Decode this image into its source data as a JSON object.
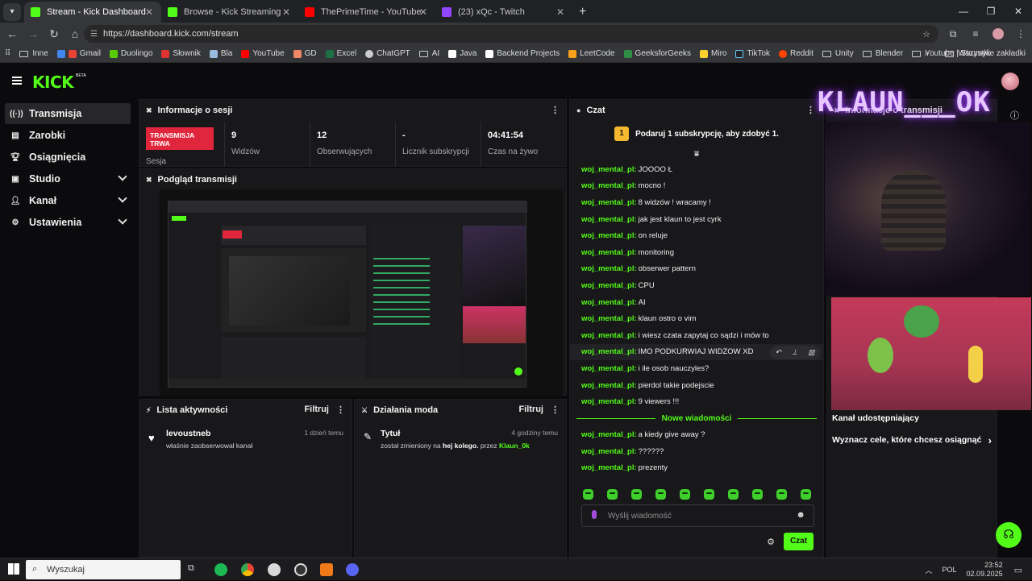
{
  "browser": {
    "tabs": [
      {
        "title": "Stream - Kick Dashboard",
        "active": true,
        "color": "#53fc18"
      },
      {
        "title": "Browse - Kick Streaming",
        "active": false,
        "color": "#53fc18"
      },
      {
        "title": "ThePrimeTime - YouTube",
        "active": false,
        "color": "#ff0000"
      },
      {
        "title": "(23) xQc - Twitch",
        "active": false,
        "color": "#9146ff"
      }
    ],
    "url": "https://dashboard.kick.com/stream",
    "bookmarks": [
      "Inne",
      "Gmail",
      "Duolingo",
      "Słownik",
      "Bla",
      "YouTube",
      "GD",
      "Excel",
      "ChatGPT",
      "AI",
      "Java",
      "Backend Projects",
      "LeetCode",
      "GeeksforGeeks",
      "Miro",
      "TikTok",
      "Reddit",
      "Unity",
      "Blender",
      "Youtube | Strumyk"
    ],
    "bookmarks_all": "Wszystkie zakładki"
  },
  "kick": {
    "logo": "KICK",
    "beta": "BETA",
    "sidebar": [
      {
        "label": "Transmisja",
        "icon": "broadcast-icon",
        "active": true,
        "chevron": false
      },
      {
        "label": "Zarobki",
        "icon": "wallet-icon",
        "active": false,
        "chevron": false
      },
      {
        "label": "Osiągnięcia",
        "icon": "trophy-icon",
        "active": false,
        "chevron": false
      },
      {
        "label": "Studio",
        "icon": "studio-icon",
        "active": false,
        "chevron": true
      },
      {
        "label": "Kanał",
        "icon": "channel-icon",
        "active": false,
        "chevron": true
      },
      {
        "label": "Ustawienia",
        "icon": "gear-icon",
        "active": false,
        "chevron": true
      }
    ],
    "session": {
      "title": "Informacje o sesji",
      "badge": "TRANSMISJA TRWA",
      "sublabel": "Sesja",
      "stats": [
        {
          "value": "9",
          "label": "Widzów"
        },
        {
          "value": "12",
          "label": "Obserwujących"
        },
        {
          "value": "-",
          "label": "Licznik subskrypcji"
        },
        {
          "value": "04:41:54",
          "label": "Czas na żywo"
        }
      ]
    },
    "preview": {
      "title": "Podgląd transmisji"
    },
    "activity": {
      "title": "Lista aktywności",
      "filter": "Filtruj",
      "items": [
        {
          "user": "levoustneb",
          "text": "właśnie zaobserwował kanał",
          "time": "1 dzień temu"
        }
      ]
    },
    "mod": {
      "title": "Działania moda",
      "filter": "Filtruj",
      "items": [
        {
          "heading": "Tytuł",
          "text_pre": "został zmieniony na",
          "bold": "hej kolego.",
          "text_mid": "przez",
          "user": "Klaun_0k",
          "time": "4 godziny temu"
        }
      ]
    },
    "chat": {
      "title": "Czat",
      "sub_goal_num": "1",
      "sub_goal": "Podaruj 1 subskrypcję, aby zdobyć 1.",
      "messages_before": [
        {
          "user": "woj_mental_pl:",
          "text": "JOOOO Ł"
        },
        {
          "user": "woj_mental_pl:",
          "text": "mocno !"
        },
        {
          "user": "woj_mental_pl:",
          "text": "8 widzów ! wracamy !"
        },
        {
          "user": "woj_mental_pl:",
          "text": "jak jest klaun to jest cyrk"
        },
        {
          "user": "woj_mental_pl:",
          "text": "on reluje"
        },
        {
          "user": "woj_mental_pl:",
          "text": "monitoring"
        },
        {
          "user": "woj_mental_pl:",
          "text": "obserwer pattern"
        },
        {
          "user": "woj_mental_pl:",
          "text": "CPU"
        },
        {
          "user": "woj_mental_pl:",
          "text": "AI"
        },
        {
          "user": "woj_mental_pl:",
          "text": "klaun ostro o vim"
        },
        {
          "user": "woj_mental_pl:",
          "text": "i wiesz czata zapytaj co sądzi i mów to"
        },
        {
          "user": "woj_mental_pl:",
          "text": "IMO PODKURWIAJ WIDZOW XD"
        },
        {
          "user": "woj_mental_pl:",
          "text": "i ile osob nauczyles?"
        },
        {
          "user": "woj_mental_pl:",
          "text": "pierdol takie podejscie"
        },
        {
          "user": "woj_mental_pl:",
          "text": "9 viewers !!!"
        }
      ],
      "new_label": "Nowe wiadomości",
      "messages_after": [
        {
          "user": "woj_mental_pl:",
          "text": "a kiedy give away ?"
        },
        {
          "user": "woj_mental_pl:",
          "text": "??????"
        },
        {
          "user": "woj_mental_pl:",
          "text": "prezenty"
        }
      ],
      "placeholder": "Wyślij wiadomość",
      "send": "Czat"
    },
    "stream_info": {
      "title": "Informacje o transmisji",
      "overlay_text": "KLAUN___OK",
      "shared": "Kanał udostępniający",
      "goals": "Wyznacz cele, które chcesz osiągnąć"
    }
  },
  "taskbar": {
    "search": "Wyszukaj",
    "lang": "POL",
    "time": "23:52",
    "date": "02.09.2025"
  }
}
